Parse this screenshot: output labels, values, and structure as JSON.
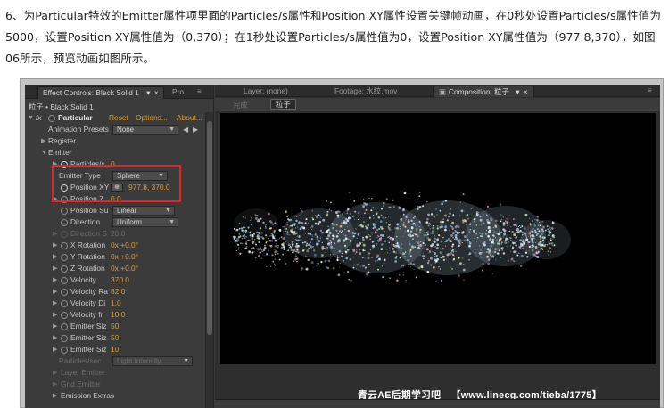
{
  "article": {
    "line1": "6、为Particular特效的Emitter属性项里面的Particles/s属性和Position XY属性设置关键帧动画，在0秒处设置Particles/s属性值为",
    "line2": "5000，设置Position XY属性值为（0,370）；在1秒处设置Particles/s属性值为0，设置Position XY属性值为（977.8,370），如图",
    "line3": "06所示，预览动画如图所示。"
  },
  "effect_controls": {
    "tab_label": "Effect Controls: Black Solid 1",
    "tab2_label": "Pro",
    "layer_path": "粒子 • Black Solid 1",
    "fx_label": "fx",
    "effect_name": "Particular",
    "reset": "Reset",
    "options": "Options...",
    "about": "About...",
    "rows": {
      "animation_presets": {
        "label": "Animation Presets",
        "value": "None"
      },
      "register": "Register",
      "emitter": "Emitter",
      "particles_s": {
        "label": "Particles/s",
        "value": "0"
      },
      "emitter_type": {
        "label": "Emitter Type",
        "value": "Sphere"
      },
      "position_xy": {
        "label": "Position XY",
        "value": "977.8, 370.0"
      },
      "position_z": {
        "label": "Position Z",
        "value": "0.0"
      },
      "position_su": {
        "label": "Position Su",
        "value": "Linear"
      },
      "direction": {
        "label": "Direction",
        "value": "Uniform"
      },
      "direction_s": {
        "label": "Direction S",
        "value": "20.0"
      },
      "x_rotation": {
        "label": "X Rotation",
        "value": "0x +0.0°"
      },
      "y_rotation": {
        "label": "Y Rotation",
        "value": "0x +0.0°"
      },
      "z_rotation": {
        "label": "Z Rotation",
        "value": "0x +0.0°"
      },
      "velocity": {
        "label": "Velocity",
        "value": "370.0"
      },
      "velocity_ra": {
        "label": "Velocity Ra",
        "value": "82.0"
      },
      "velocity_di": {
        "label": "Velocity Di",
        "value": "1.0"
      },
      "velocity_fr": {
        "label": "Velocity fr",
        "value": "10.0"
      },
      "emitter_siz_1": {
        "label": "Emitter Siz",
        "value": "50"
      },
      "emitter_siz_2": {
        "label": "Emitter Siz",
        "value": "50"
      },
      "emitter_siz_3": {
        "label": "Emitter Siz",
        "value": "10"
      },
      "particles_sec": {
        "label": "Particles/sec",
        "value": "Light Intensity"
      },
      "layer_emitter": "Layer Emitter",
      "grid_emitter": "Grid Emitter",
      "emission_extras": "Emission Extras"
    }
  },
  "viewer": {
    "tab_layer": "Layer: (none)",
    "tab_footage": "Footage: 水紋.mov",
    "tab_comp": "Composition: 粒子",
    "crumb_prev": "完成",
    "crumb_current": "粒子"
  },
  "watermark": {
    "site_name": "青云AE后期学习吧",
    "url": "【www.linecg.com/tieba/1775】"
  },
  "colors": {
    "value_orange": "#e09a2a",
    "highlight_red": "#e0252b",
    "panel_bg": "#3b3b3b"
  },
  "icons": {
    "stopwatch": "stopwatch-icon",
    "twirl": "twirl-triangle-icon",
    "crosshair": "crosshair-icon"
  }
}
